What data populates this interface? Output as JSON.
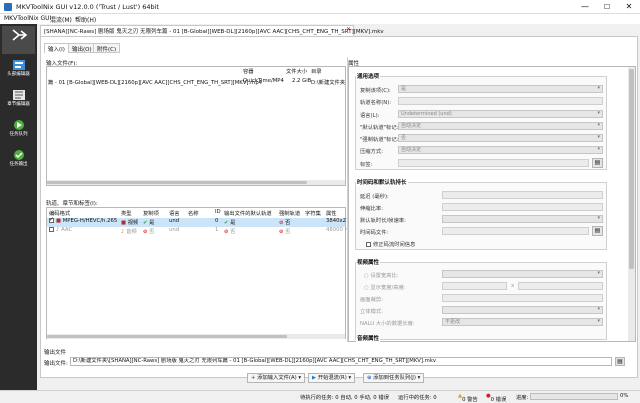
{
  "window": {
    "title": "MKVToolNix GUI v12.0.0 ('Trust / Lust') 64bit",
    "minimize": "—",
    "maximize": "☐",
    "close": "✕"
  },
  "menu": [
    "MKVToolNix GUI",
    "混流(M)",
    "帮助(H)"
  ],
  "sidebar": {
    "items": [
      {
        "label": "",
        "icon": "multiplex-icon"
      },
      {
        "label": "头部编辑器",
        "icon": "header-editor-icon"
      },
      {
        "label": "章节编辑器",
        "icon": "chapter-editor-icon"
      },
      {
        "label": "任务队列",
        "icon": "job-queue-icon"
      },
      {
        "label": "任务输出",
        "icon": "job-output-icon"
      }
    ]
  },
  "file_tab": {
    "label": "[SHANA][NC-Raws] 剧场版 鬼灭之刃 无限列车篇 - 01 [B-Global][WEB-DL][2160p][AVC AAC][CHS_CHT_ENG_TH_SRT][MKV].mkv",
    "close": "✕"
  },
  "tabs": [
    "输入(I)",
    "输出(O)",
    "附件(C)"
  ],
  "input": {
    "section_label": "输入文件(F):",
    "headers": [
      "",
      "容器",
      "文件大小",
      "目录"
    ],
    "row": {
      "name": "篇 - 01 [B-Global][WEB-DL][2160p][AVC AAC][CHS_CHT_ENG_TH_SRT][MKV].mp4",
      "container": "QuickTime/MP4",
      "size": "2.2 GiB",
      "dir": "D:\\新建文件夹"
    }
  },
  "tracks": {
    "section_label": "轨道、章节和标签(I):",
    "headers": [
      "编码格式",
      "类型",
      "复制项",
      "语言",
      "名称",
      "ID",
      "输出文件的默认轨道",
      "强制轨道",
      "字符集",
      "属性"
    ],
    "rows": [
      {
        "codec": "MPEG-H/HEVC/h.265",
        "type": "视频",
        "copy": "是",
        "lang": "und",
        "name": "",
        "id": "0",
        "default": "是",
        "forced": "否",
        "charset": "",
        "props": "3840x21",
        "checked": true
      },
      {
        "codec": "AAC",
        "type": "音频",
        "copy": "否",
        "lang": "und",
        "name": "",
        "id": "1",
        "default": "否",
        "forced": "否",
        "charset": "",
        "props": "48000 H",
        "checked": false
      }
    ]
  },
  "properties": {
    "label": "属性",
    "general_title": "通用选项",
    "general": [
      {
        "label": "复制该项(C):",
        "value": "是"
      },
      {
        "label": "轨道名称(N):",
        "value": ""
      },
      {
        "label": "语言(L):",
        "value": "Undetermined (und)"
      },
      {
        "label": "\"默认轨道\"标记:",
        "value": "自动决定"
      },
      {
        "label": "\"强制轨道\"标记:",
        "value": "否"
      },
      {
        "label": "压缩方式:",
        "value": "自动决定"
      },
      {
        "label": "标签:",
        "value": ""
      }
    ],
    "timing_title": "时间码和默认轨持长",
    "timing": [
      "延迟 (毫秒):",
      "伸缩比率:",
      "默认轨时长/帧速率:",
      "时间码文件:"
    ],
    "timing_checkbox": "修正码流时间信息",
    "video_title": "视频属性",
    "video": [
      "设置宽高比:",
      "显示宽度/高度:",
      "画面裁剪:",
      "立体模式:",
      "NALU 大小的数据长度:"
    ],
    "video_x": "x",
    "nalu_value": "不更改",
    "audio_title": "音频属性"
  },
  "output": {
    "section_label": "输出文件",
    "file_label": "输出文件:",
    "path": "D:\\新建文件夹\\[SHANA][NC-Raws] 剧场版 鬼灭之刃 无限列车篇 - 01 [B-Global][WEB-DL][2160p][AVC AAC][CHS_CHT_ENG_TH_SRT][MKV].mkv"
  },
  "actions": {
    "add_source": "添加输入文件(A)",
    "start": "开始混流(R)",
    "add_job": "添加到任务队列(J)"
  },
  "status": {
    "pending": "待执行的任务: 0 自动, 0 手动, 0 错误",
    "running": "运行中的任务: 0",
    "warnings": "0 警告",
    "errors": "0 错误",
    "progress_label": "进度:",
    "progress_pct": "0%"
  },
  "colors": {
    "sidebar": "#2b2b2b",
    "selection": "#cce4f7",
    "accent": "#2c6fb7"
  }
}
